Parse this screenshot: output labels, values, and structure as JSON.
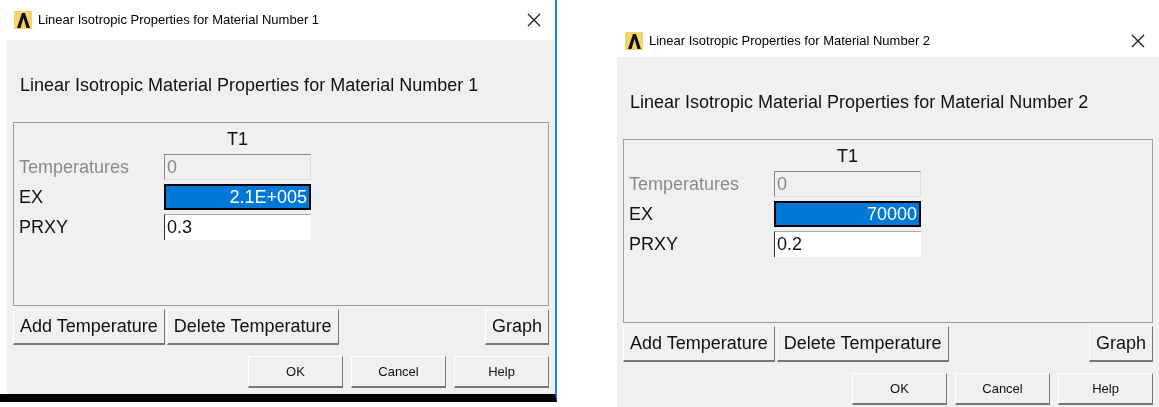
{
  "dialogs": [
    {
      "title": "Linear Isotropic Properties for Material Number 1",
      "heading": "Linear Isotropic Material Properties for Material Number 1",
      "column_header": "T1",
      "rows": [
        {
          "label": "Temperatures",
          "value": "0",
          "disabled": true,
          "selected": false
        },
        {
          "label": "EX",
          "value": "2.1E+005",
          "disabled": false,
          "selected": true
        },
        {
          "label": "PRXY",
          "value": "0.3",
          "disabled": false,
          "selected": false
        }
      ],
      "table_buttons": [
        "Add Temperature",
        "Delete Temperature"
      ],
      "graph_button": "Graph",
      "footer_buttons": [
        "OK",
        "Cancel",
        "Help"
      ]
    },
    {
      "title": "Linear Isotropic Properties for Material Number 2",
      "heading": "Linear Isotropic Material Properties for Material Number 2",
      "column_header": "T1",
      "rows": [
        {
          "label": "Temperatures",
          "value": "0",
          "disabled": true,
          "selected": false
        },
        {
          "label": "EX",
          "value": "70000",
          "disabled": false,
          "selected": true
        },
        {
          "label": "PRXY",
          "value": "0.2",
          "disabled": false,
          "selected": false
        }
      ],
      "table_buttons": [
        "Add Temperature",
        "Delete Temperature"
      ],
      "graph_button": "Graph",
      "footer_buttons": [
        "OK",
        "Cancel",
        "Help"
      ]
    }
  ]
}
